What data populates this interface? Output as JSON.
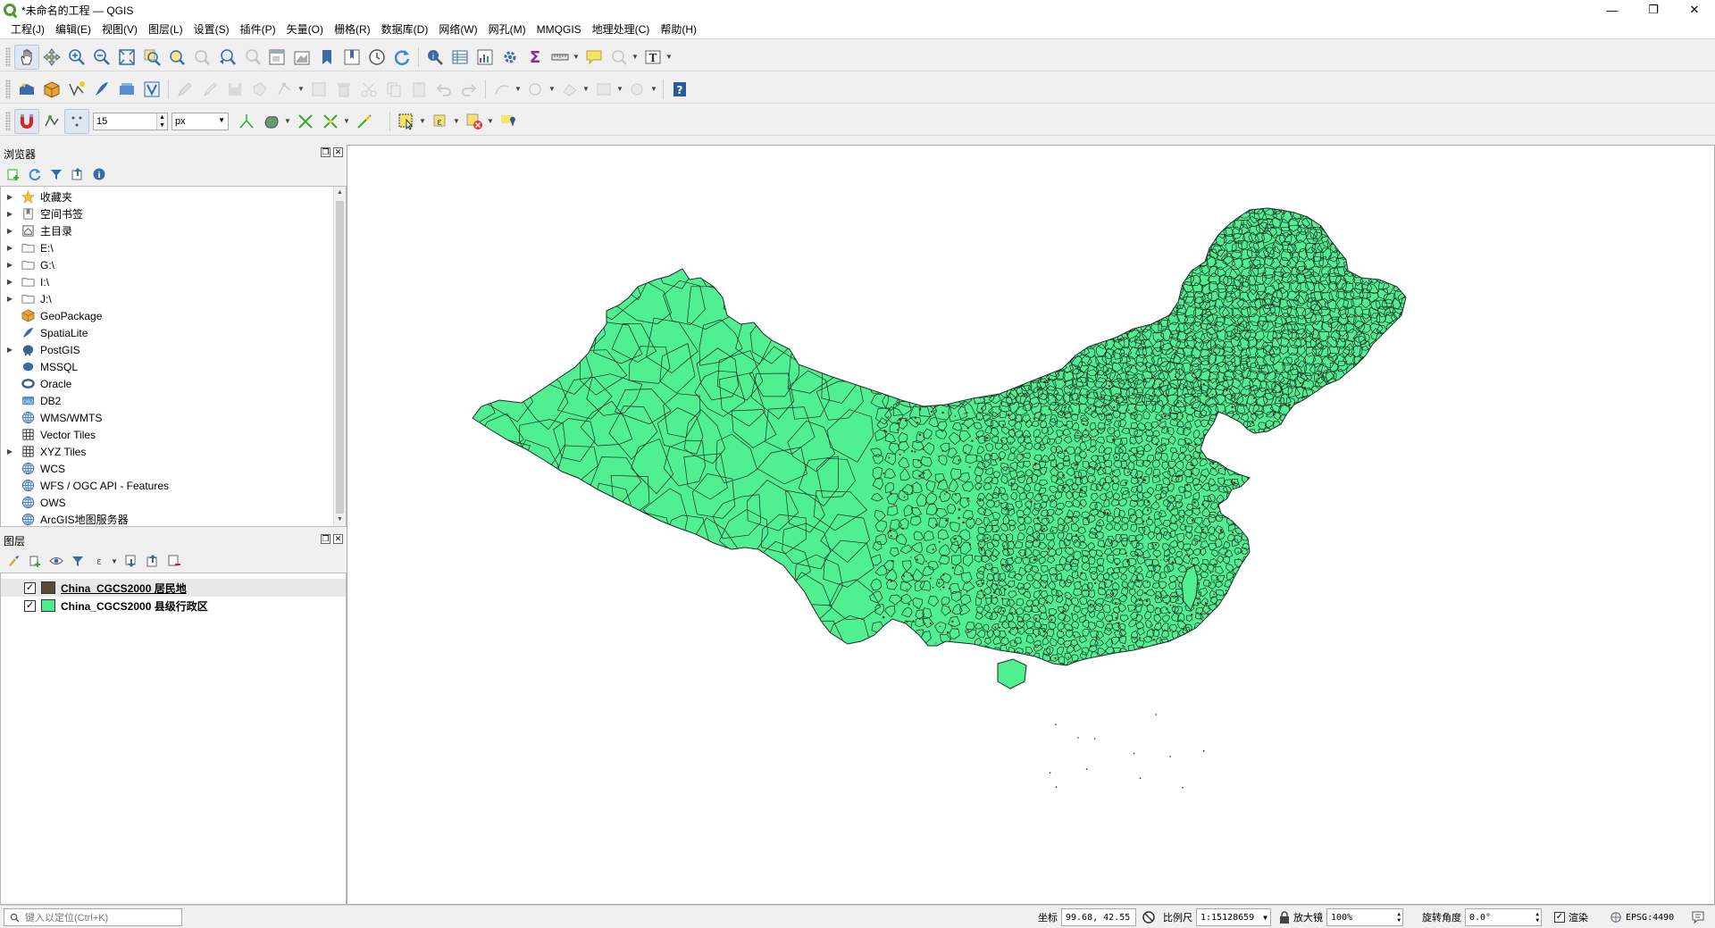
{
  "window": {
    "title": "*未命名的工程 — QGIS",
    "minimize": "—",
    "maximize": "❐",
    "close": "✕"
  },
  "menu": [
    "工程(J)",
    "编辑(E)",
    "视图(V)",
    "图层(L)",
    "设置(S)",
    "插件(P)",
    "矢量(O)",
    "栅格(R)",
    "数据库(D)",
    "网络(W)",
    "网孔(M)",
    "MMQGIS",
    "地理处理(C)",
    "帮助(H)"
  ],
  "snapping": {
    "tolerance": "15",
    "unit": "px"
  },
  "browser": {
    "title": "浏览器",
    "items": [
      {
        "label": "收藏夹",
        "icon": "star-icon",
        "expandable": true
      },
      {
        "label": "空间书签",
        "icon": "bookmark-icon",
        "expandable": true
      },
      {
        "label": "主目录",
        "icon": "home-icon",
        "expandable": true
      },
      {
        "label": "E:\\",
        "icon": "folder-icon",
        "expandable": true
      },
      {
        "label": "G:\\",
        "icon": "folder-icon",
        "expandable": true
      },
      {
        "label": "I:\\",
        "icon": "folder-icon",
        "expandable": true
      },
      {
        "label": "J:\\",
        "icon": "folder-icon",
        "expandable": true
      },
      {
        "label": "GeoPackage",
        "icon": "geopackage-icon",
        "expandable": false
      },
      {
        "label": "SpatiaLite",
        "icon": "spatialite-icon",
        "expandable": false
      },
      {
        "label": "PostGIS",
        "icon": "postgis-elephant-icon",
        "expandable": true
      },
      {
        "label": "MSSQL",
        "icon": "mssql-icon",
        "expandable": false
      },
      {
        "label": "Oracle",
        "icon": "oracle-icon",
        "expandable": false
      },
      {
        "label": "DB2",
        "icon": "db2-icon",
        "expandable": false
      },
      {
        "label": "WMS/WMTS",
        "icon": "globe-icon",
        "expandable": false
      },
      {
        "label": "Vector Tiles",
        "icon": "grid-icon",
        "expandable": false
      },
      {
        "label": "XYZ Tiles",
        "icon": "grid-icon",
        "expandable": true
      },
      {
        "label": "WCS",
        "icon": "globe-icon",
        "expandable": false
      },
      {
        "label": "WFS / OGC API - Features",
        "icon": "globe-icon",
        "expandable": false
      },
      {
        "label": "OWS",
        "icon": "globe-icon",
        "expandable": false
      },
      {
        "label": "ArcGIS地图服务器",
        "icon": "globe-icon",
        "expandable": false
      }
    ]
  },
  "layers": {
    "title": "图层",
    "items": [
      {
        "label": "China_CGCS2000 居民地",
        "checked": "✓",
        "color": "#5a4a3a"
      },
      {
        "label": "China_CGCS2000 县级行政区",
        "checked": "✓",
        "color": "#4ceb8c"
      }
    ]
  },
  "map": {
    "fill_color": "#50ef91",
    "line_color": "#1e2a22",
    "dot_color": "#6b2418"
  },
  "status": {
    "locator_placeholder": "键入以定位(Ctrl+K)",
    "coord_label": "坐标",
    "coord_value": "99.68, 42.55",
    "scale_label": "比例尺",
    "scale_value": "1:15128659",
    "magnifier_label": "放大镜",
    "magnifier_value": "100%",
    "rotation_label": "旋转角度",
    "rotation_value": "0.0°",
    "render_label": "渲染",
    "crs_value": "EPSG:4490"
  }
}
